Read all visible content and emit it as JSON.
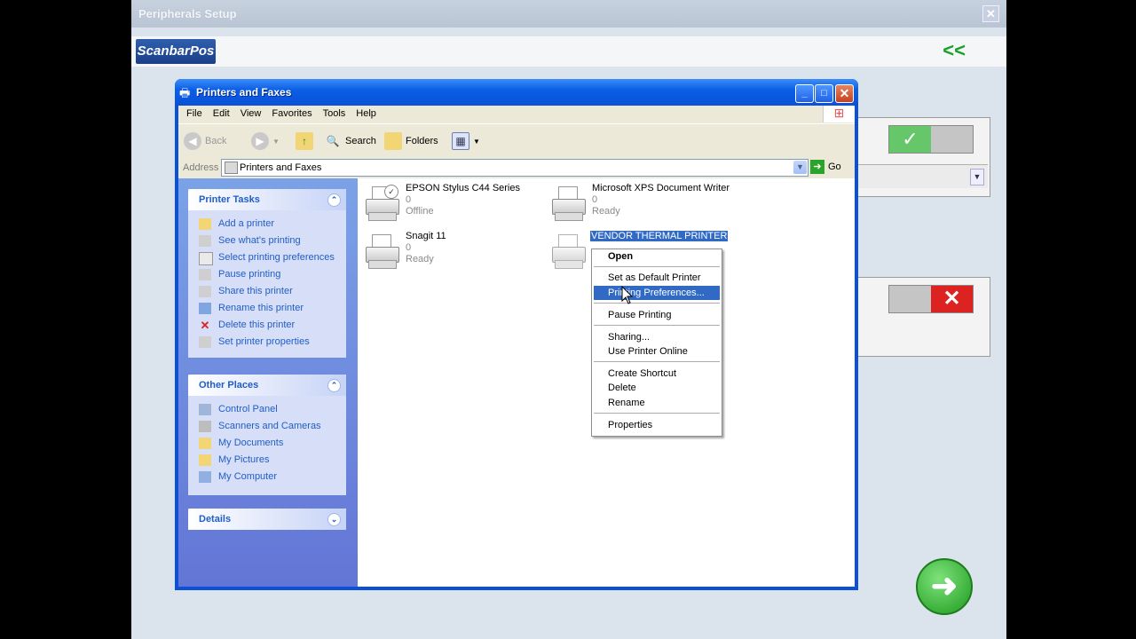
{
  "bg_app": {
    "title": "Peripherals Setup",
    "logo": "ScanbarPos",
    "back_label": "<<",
    "confirm_icon": "check-icon",
    "cancel_icon": "x-icon",
    "next_icon": "arrow-right-icon"
  },
  "window": {
    "title": "Printers and Faxes",
    "controls": [
      "minimize",
      "maximize",
      "close"
    ]
  },
  "menubar": [
    "File",
    "Edit",
    "View",
    "Favorites",
    "Tools",
    "Help"
  ],
  "toolbar": {
    "back": "Back",
    "search": "Search",
    "folders": "Folders"
  },
  "address": {
    "label": "Address",
    "value": "Printers and Faxes",
    "go": "Go"
  },
  "printer_tasks": {
    "title": "Printer Tasks",
    "items": [
      "Add a printer",
      "See what's printing",
      "Select printing preferences",
      "Pause printing",
      "Share this printer",
      "Rename this printer",
      "Delete this printer",
      "Set printer properties"
    ]
  },
  "other_places": {
    "title": "Other Places",
    "items": [
      "Control Panel",
      "Scanners and Cameras",
      "My Documents",
      "My Pictures",
      "My Computer"
    ]
  },
  "details": {
    "title": "Details"
  },
  "printers": [
    {
      "name": "EPSON Stylus C44 Series",
      "count": "0",
      "status": "Offline",
      "default": true
    },
    {
      "name": "Microsoft XPS Document Writer",
      "count": "0",
      "status": "Ready",
      "default": false
    },
    {
      "name": "Snagit 11",
      "count": "0",
      "status": "Ready",
      "default": false
    },
    {
      "name": "VENDOR THERMAL PRINTER",
      "count": "",
      "status": "",
      "default": false,
      "selected": true
    }
  ],
  "context_menu": {
    "open": "Open",
    "set_default": "Set as Default Printer",
    "printing_prefs": "Printing Preferences...",
    "pause": "Pause Printing",
    "sharing": "Sharing...",
    "use_online": "Use Printer Online",
    "create_shortcut": "Create Shortcut",
    "delete": "Delete",
    "rename": "Rename",
    "properties": "Properties"
  }
}
